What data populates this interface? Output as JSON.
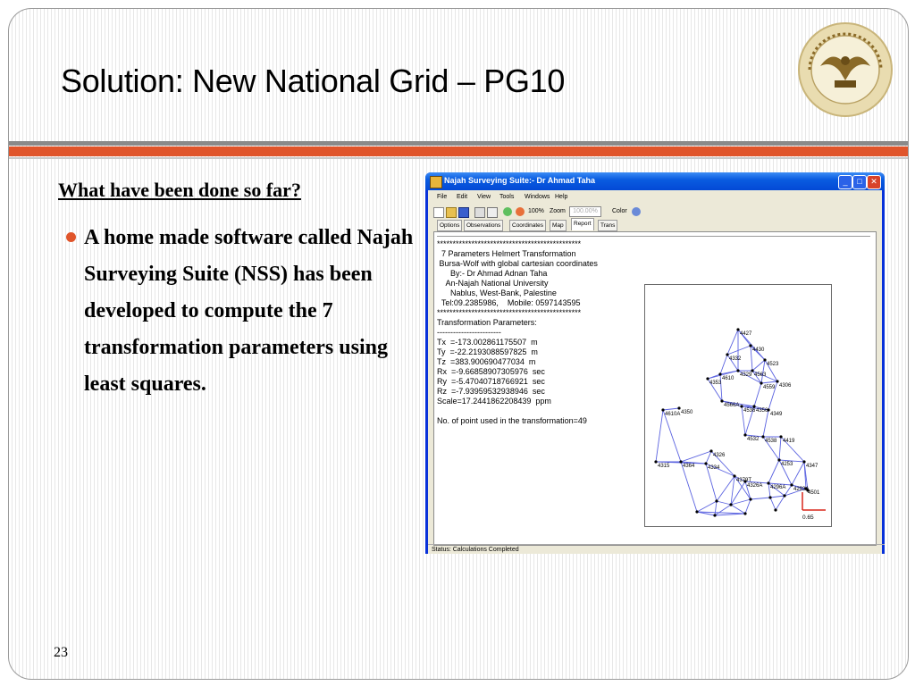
{
  "slide": {
    "title": "Solution: New National Grid – PG10",
    "heading": "What have been done so far?",
    "bullet": "A home made software called Najah Surveying Suite (NSS) has been developed to compute the 7 transformation parameters using least squares.",
    "page_number": "23"
  },
  "colors": {
    "accent": "#e0552b",
    "title_bar": "#0349d6"
  },
  "app": {
    "window_title": "Najah Surveying Suite:- Dr Ahmad Taha",
    "menu": [
      "File",
      "Edit",
      "View",
      "Tools",
      "Windows",
      "Help"
    ],
    "toolbar": {
      "zoom_value": "100%",
      "zoom_label": "Zoom",
      "zoom_field": "100.00%",
      "color_label": "Color"
    },
    "tabs": [
      "Options",
      "Observations",
      "Coordinates",
      "Map",
      "Report",
      "Trans"
    ],
    "active_tab": "Report",
    "report_lines": [
      "**********************************************",
      "  7 Parameters Helmert Transformation",
      " Bursa-Wolf with global cartesian coordinates",
      "      By:- Dr Ahmad Adnan Taha",
      "    An-Najah National University",
      "      Nablus, West-Bank, Palestine",
      "  Tel:09.2385986,    Mobile: 0597143595",
      "**********************************************",
      "Transformation Parameters:",
      "------------------------",
      "Tx  =-173.002861175507  m",
      "Ty  =-22.2193088597825  m",
      "Tz  =383.900690477034  m",
      "Rx  =-9.66858907305976  sec",
      "Ry  =-5.47040718766921  sec",
      "Rz  =-7.93959532938946  sec",
      "Scale=17.2441862208439  ppm",
      "",
      "No. of point used in the transformation=49"
    ],
    "network_labels": [
      "4427",
      "4430",
      "4332",
      "4523",
      "4306",
      "4610",
      "4353",
      "4329",
      "4563",
      "4559",
      "4566A",
      "4536",
      "4356",
      "4349",
      "4350",
      "4610A",
      "4532",
      "4538",
      "4419",
      "4326",
      "4315",
      "4364",
      "4334",
      "4379T",
      "4253",
      "4347",
      "4326A",
      "4296A",
      "4293A",
      "4501",
      "0.65"
    ],
    "status": "Status: Calculations Completed"
  }
}
